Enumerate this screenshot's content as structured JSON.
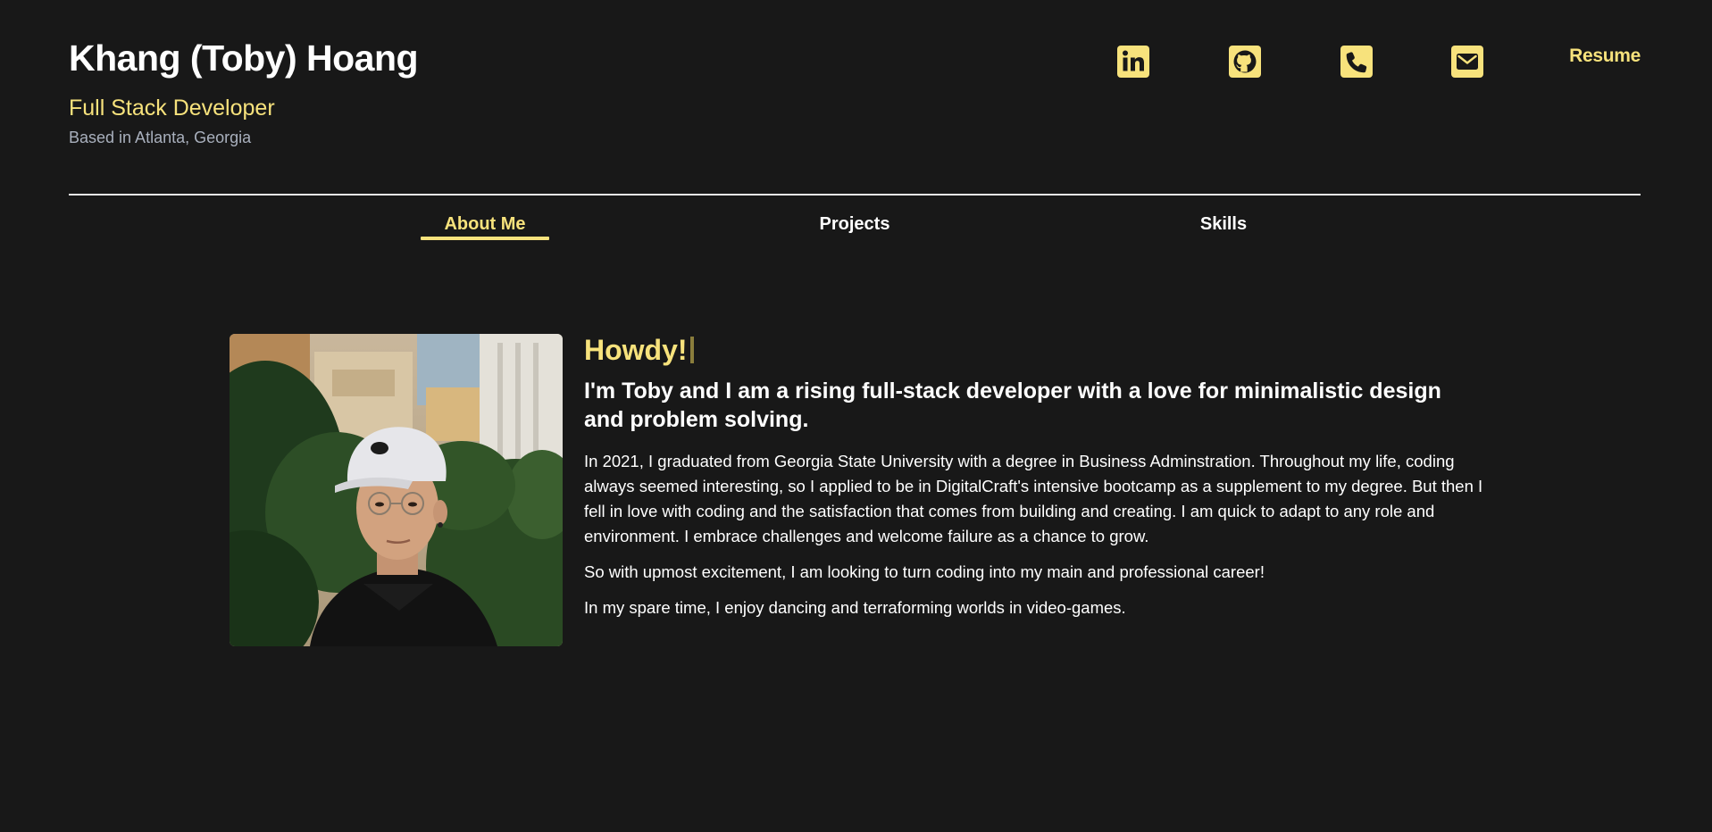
{
  "header": {
    "name": "Khang (Toby) Hoang",
    "role": "Full Stack Developer",
    "location": "Based in Atlanta, Georgia",
    "resume_label": "Resume"
  },
  "social": [
    {
      "icon": "linkedin-icon"
    },
    {
      "icon": "github-icon"
    },
    {
      "icon": "phone-icon"
    },
    {
      "icon": "envelope-icon"
    }
  ],
  "tabs": [
    {
      "label": "About Me",
      "active": true
    },
    {
      "label": "Projects",
      "active": false
    },
    {
      "label": "Skills",
      "active": false
    }
  ],
  "about": {
    "greeting": "Howdy!",
    "headline": "I'm Toby and I am a rising full-stack developer with a love for minimalistic design and problem solving.",
    "paragraphs": [
      "In 2021, I graduated from Georgia State University with a degree in Business Adminstration. Throughout my life, coding always seemed interesting, so I applied to be in DigitalCraft's intensive bootcamp as a supplement to my degree. But then I fell in love with coding and the satisfaction that comes from building and creating. I am quick to adapt to any role and environment. I embrace challenges and welcome failure as a chance to grow.",
      "So with upmost excitement, I am looking to turn coding into my main and professional career!",
      "In my spare time, I enjoy dancing and terraforming worlds in video-games."
    ]
  },
  "colors": {
    "background": "#181818",
    "accent": "#f7e27c",
    "muted": "#a9b0bd",
    "text": "#ffffff"
  }
}
